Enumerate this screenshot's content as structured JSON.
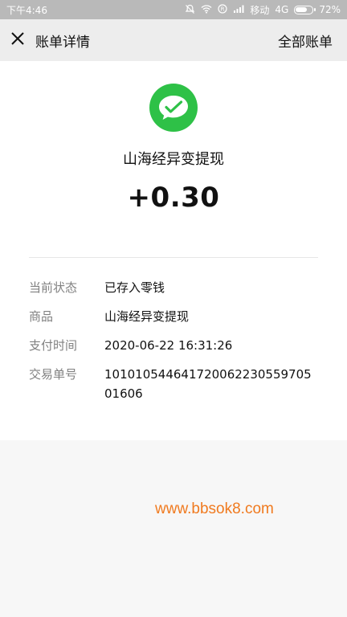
{
  "status_bar": {
    "time": "下午4:46",
    "carrier": "移动",
    "network": "4G",
    "battery": "72%",
    "battery_level": 0.72
  },
  "header": {
    "title": "账单详情",
    "all_bills_label": "全部账单"
  },
  "transaction": {
    "merchant": "山海经异变提现",
    "amount": "+0.30",
    "icon": "wechat-pay-logo",
    "icon_color": "#2ec147"
  },
  "details": [
    {
      "label": "当前状态",
      "value": "已存入零钱"
    },
    {
      "label": "商品",
      "value": "山海经异变提现"
    },
    {
      "label": "支付时间",
      "value": "2020-06-22 16:31:26"
    },
    {
      "label": "交易单号",
      "value": "10101054464172006223055970501606"
    }
  ],
  "watermark": "www.bbsok8.com"
}
